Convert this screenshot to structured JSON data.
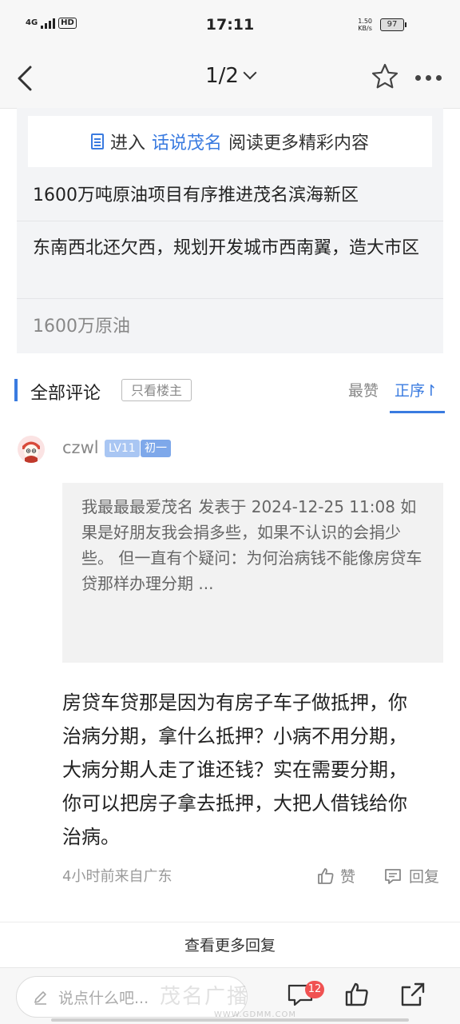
{
  "status_bar": {
    "network": "4G",
    "hd": "HD",
    "time": "17:11",
    "speed_value": "1.50",
    "speed_unit": "KB/s",
    "battery": "97"
  },
  "nav": {
    "page_indicator": "1/2"
  },
  "related": {
    "enter_prefix": "进入",
    "enter_link": "话说茂名",
    "enter_suffix": "阅读更多精彩内容",
    "items": [
      "1600万吨原油项目有序推进茂名滨海新区",
      "东南西北还欠西，规划开发城市西南翼，造大市区",
      "1600万原油"
    ]
  },
  "comments_header": {
    "title": "全部评论",
    "only_owner": "只看楼主",
    "sort_hot": "最赞",
    "sort_order": "正序↾"
  },
  "comment": {
    "username": "czwl",
    "level": "LV11",
    "rank": "初一",
    "quote": "我最最最爱茂名 发表于 2024-12-25 11:08 如果是好朋友我会捐多些，如果不认识的会捐少些。 但一直有个疑问：为何治病钱不能像房贷车贷那样办理分期 ...",
    "body": "房贷车贷那是因为有房子车子做抵押，你治病分期，拿什么抵押？小病不用分期，大病分期人走了谁还钱？实在需要分期，你可以把房子拿去抵押，大把人借钱给你治病。",
    "meta": "4小时前来自广东",
    "like_label": "赞",
    "reply_label": "回复"
  },
  "more_replies": "查看更多回复",
  "bottom_bar": {
    "input_placeholder": "说点什么吧...",
    "comment_count": "12"
  },
  "watermark": {
    "text": "茂名广播",
    "url": "WWW.GDMM.COM"
  },
  "colors": {
    "accent": "#3a7be0",
    "badge_red": "#f05252"
  }
}
